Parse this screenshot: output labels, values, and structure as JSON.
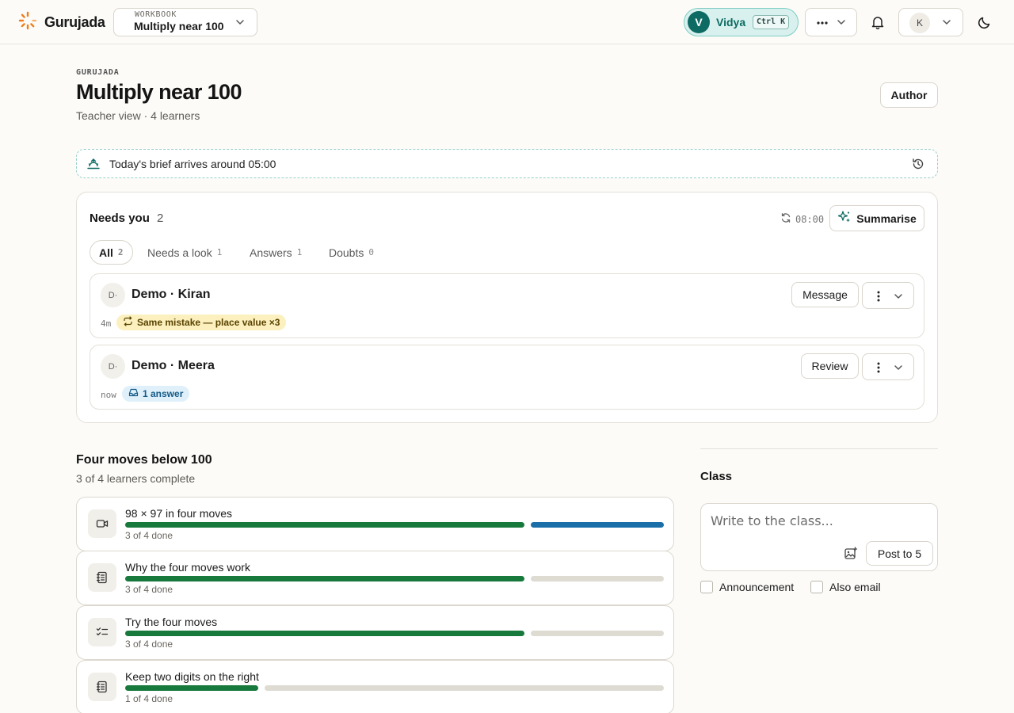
{
  "app": {
    "name": "Gurujada"
  },
  "workbook": {
    "kicker": "WORKBOOK",
    "title": "Multiply near 100"
  },
  "user": {
    "initial": "V",
    "name": "Vidya",
    "shortcut": "Ctrl K"
  },
  "profile": {
    "initial": "K"
  },
  "header": {
    "kicker": "GURUJADA",
    "title": "Multiply near 100",
    "subtitle": "Teacher view · 4 learners",
    "author_label": "Author"
  },
  "brief": {
    "text": "Today's brief arrives around 05:00"
  },
  "needs": {
    "title": "Needs you",
    "count": "2",
    "sync_time": "08:00",
    "summarise_label": "Summarise",
    "filters": [
      {
        "label": "All",
        "count": "2"
      },
      {
        "label": "Needs a look",
        "count": "1"
      },
      {
        "label": "Answers",
        "count": "1"
      },
      {
        "label": "Doubts",
        "count": "0"
      }
    ],
    "items": [
      {
        "initial": "D·",
        "name": "Demo · Kiran",
        "time": "4m",
        "tag": "Same mistake — place value ×3",
        "action": "Message"
      },
      {
        "initial": "D·",
        "name": "Demo · Meera",
        "time": "now",
        "tag": "1 answer",
        "action": "Review"
      }
    ]
  },
  "lessons": {
    "title": "Four moves below 100",
    "subtitle": "3 of 4 learners complete",
    "items": [
      {
        "icon": "video-icon",
        "title": "98 × 97 in four moves",
        "status": "3 of 4 done",
        "done": 3,
        "in_progress": 1,
        "total": 4
      },
      {
        "icon": "notebook-icon",
        "title": "Why the four moves work",
        "status": "3 of 4 done",
        "done": 3,
        "in_progress": 0,
        "total": 4
      },
      {
        "icon": "checklist-icon",
        "title": "Try the four moves",
        "status": "3 of 4 done",
        "done": 3,
        "in_progress": 0,
        "total": 4
      },
      {
        "icon": "notebook-icon",
        "title": "Keep two digits on the right",
        "status": "1 of 4 done",
        "done": 1,
        "in_progress": 0,
        "total": 4
      }
    ]
  },
  "class": {
    "title": "Class",
    "placeholder": "Write to the class...",
    "post_label": "Post to 5",
    "announcement_label": "Announcement",
    "email_label": "Also email"
  },
  "colors": {
    "accent": "#0d6b63",
    "done": "#18793d",
    "in_progress": "#1b6fa8",
    "todo": "#dedbd3",
    "brand": "#f07d1a"
  }
}
